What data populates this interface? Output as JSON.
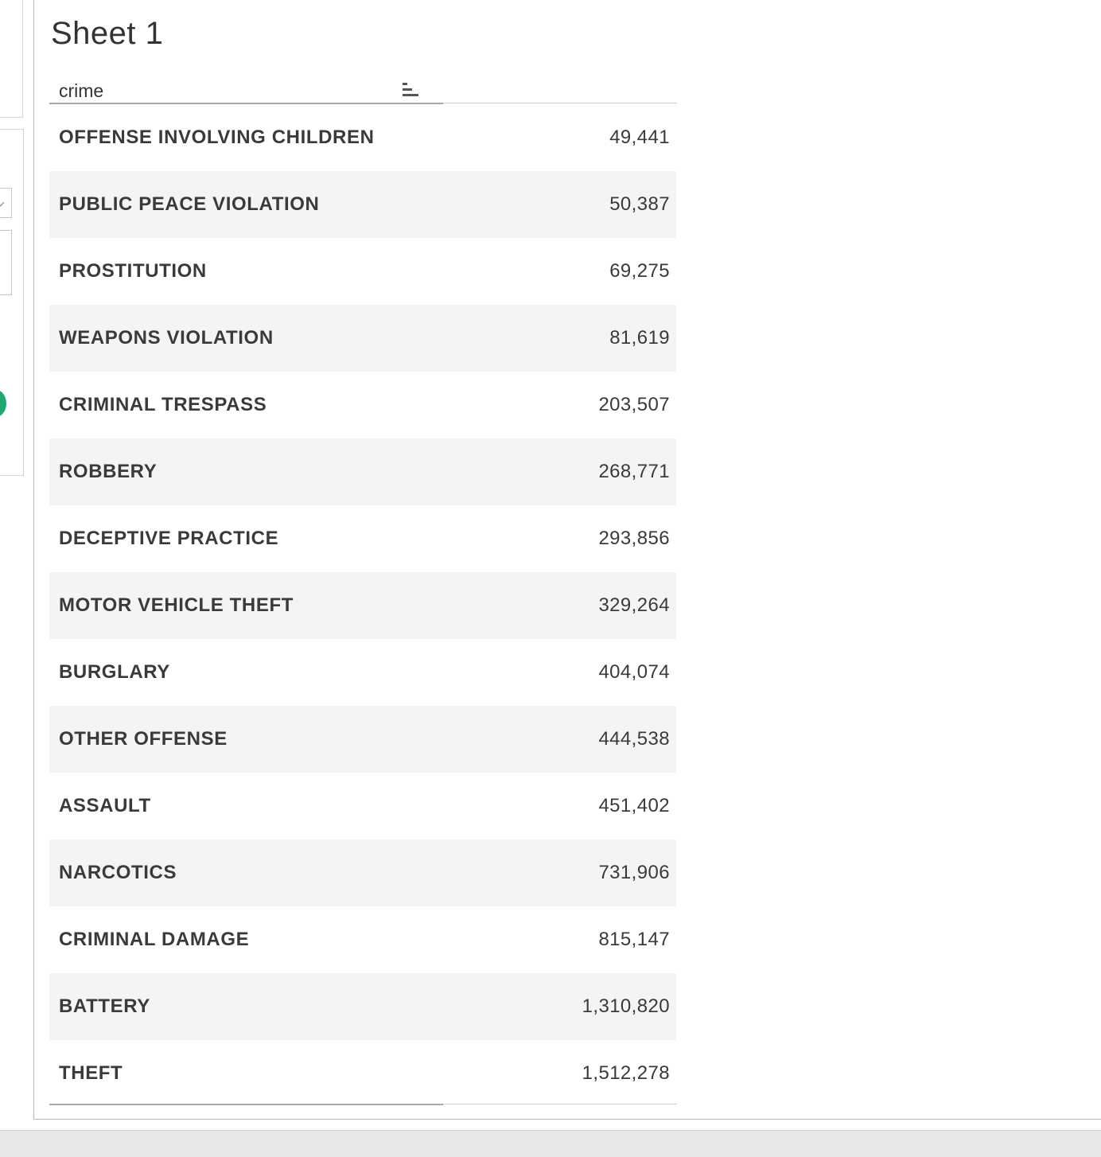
{
  "sheet": {
    "title": "Sheet 1"
  },
  "table": {
    "header": {
      "column_label": "crime",
      "sort_icon": "sort-descending-bars-icon"
    },
    "rows": [
      {
        "crime": "OFFENSE INVOLVING CHILDREN",
        "count": "49,441"
      },
      {
        "crime": "PUBLIC PEACE VIOLATION",
        "count": "50,387"
      },
      {
        "crime": "PROSTITUTION",
        "count": "69,275"
      },
      {
        "crime": "WEAPONS VIOLATION",
        "count": "81,619"
      },
      {
        "crime": "CRIMINAL TRESPASS",
        "count": "203,507"
      },
      {
        "crime": "ROBBERY",
        "count": "268,771"
      },
      {
        "crime": "DECEPTIVE PRACTICE",
        "count": "293,856"
      },
      {
        "crime": "MOTOR VEHICLE THEFT",
        "count": "329,264"
      },
      {
        "crime": "BURGLARY",
        "count": "404,074"
      },
      {
        "crime": "OTHER OFFENSE",
        "count": "444,538"
      },
      {
        "crime": "ASSAULT",
        "count": "451,402"
      },
      {
        "crime": "NARCOTICS",
        "count": "731,906"
      },
      {
        "crime": "CRIMINAL DAMAGE",
        "count": "815,147"
      },
      {
        "crime": "BATTERY",
        "count": "1,310,820"
      },
      {
        "crime": "THEFT",
        "count": "1,512,278"
      }
    ]
  },
  "colors": {
    "row_alt_background": "#f4f4f4",
    "text": "#333333",
    "side_indicator": "#1fa774"
  }
}
